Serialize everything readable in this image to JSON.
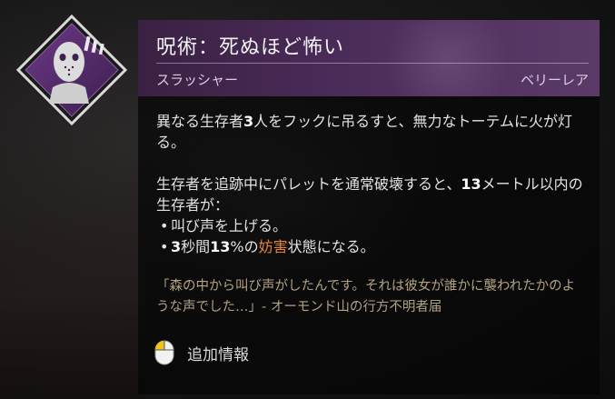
{
  "perk": {
    "title": "呪術：死ぬほど怖い",
    "owner": "スラッシャー",
    "rarity": "ベリーレア",
    "desc": {
      "p1_pre": "異なる生存者",
      "p1_num": "3",
      "p1_post": "人をフックに吊るすと、無力なトーテムに火が灯る。",
      "p2_pre": "生存者を追跡中にパレットを通常破壊すると、",
      "p2_num": "13",
      "p2_post": "メートル以内の生存者が：",
      "bullet1": "叫び声を上げる。",
      "bullet2_num1": "3",
      "bullet2_mid": "秒間",
      "bullet2_num2": "13",
      "bullet2_pct": "%の",
      "bullet2_status": "妨害",
      "bullet2_post": "状態になる。"
    },
    "flavor": "「森の中から叫び声がしたんです。それは彼女が誰かに襲われたかのような声でした…」- オーモンド山の行方不明者届"
  },
  "footer": {
    "more_info_label": "追加情報"
  },
  "colors": {
    "header": "#4a2a57",
    "status_highlight": "#e8823a",
    "flavor_text": "#b3a183",
    "badge_fill": "#5a2f73"
  },
  "icons": {
    "perk": "slasher-mask-perk-icon",
    "mouse": "mouse-left-click-icon"
  }
}
